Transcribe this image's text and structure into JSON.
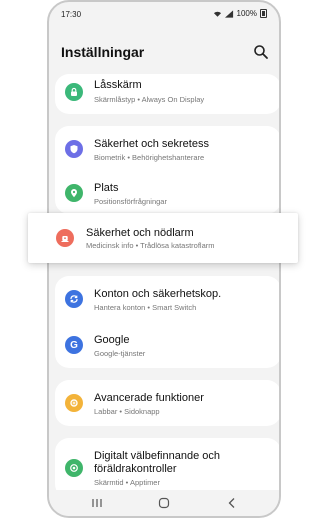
{
  "status": {
    "time": "17:30",
    "battery": "100%"
  },
  "header": {
    "title": "Inställningar"
  },
  "items": [
    {
      "title": "Låsskärm",
      "subtitle": "Skärmlåstyp • Always On Display",
      "color": "#3bb87a",
      "icon": "lock-icon"
    },
    {
      "title": "Säkerhet och sekretess",
      "subtitle": "Biometrik • Behörighetshanterare",
      "color": "#6d6fe6",
      "icon": "shield-icon"
    },
    {
      "title": "Plats",
      "subtitle": "Positionsförfrågningar",
      "color": "#3fb56a",
      "icon": "location-pin-icon"
    },
    {
      "title": "Säkerhet och nödlarm",
      "subtitle": "Medicinsk info • Trådlösa katastroflarm",
      "color": "#ee6d5d",
      "icon": "emergency-icon"
    },
    {
      "title": "Konton och säkerhetskop.",
      "subtitle": "Hantera konton • Smart Switch",
      "color": "#3d73e0",
      "icon": "sync-icon"
    },
    {
      "title": "Google",
      "subtitle": "Google-tjänster",
      "color": "#3d73e0",
      "icon": "google-icon"
    },
    {
      "title": "Avancerade funktioner",
      "subtitle": "Labbar • Sidoknapp",
      "color": "#f3b33a",
      "icon": "gear-plus-icon"
    },
    {
      "title": "Digitalt välbefinnande och föräldrakontroller",
      "title_line1": "Digitalt välbefinnande och",
      "title_line2": "föräldrakontroller",
      "subtitle": "Skärmtid • Apptimer",
      "color": "#3fb56a",
      "icon": "wellbeing-icon"
    }
  ],
  "navbar": {
    "recents": "recents-icon",
    "home": "home-icon",
    "back": "back-icon"
  }
}
